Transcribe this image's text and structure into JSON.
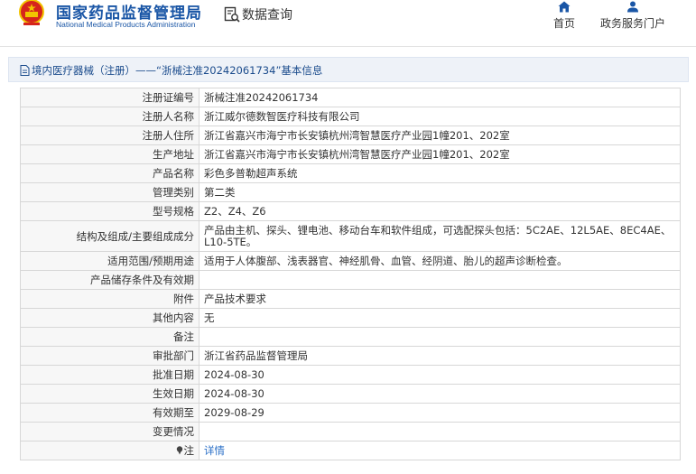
{
  "header": {
    "brand_cn": "国家药品监督管理局",
    "brand_en": "National Medical Products Administration",
    "query_label": "数据查询",
    "nav": {
      "home": "首页",
      "portal": "政务服务门户"
    }
  },
  "breadcrumb": {
    "text": "境内医疗器械（注册）——“浙械注准20242061734”基本信息"
  },
  "rows": [
    {
      "label": "注册证编号",
      "value": "浙械注准20242061734"
    },
    {
      "label": "注册人名称",
      "value": "浙江威尔德数智医疗科技有限公司"
    },
    {
      "label": "注册人住所",
      "value": "浙江省嘉兴市海宁市长安镇杭州湾智慧医疗产业园1幢201、202室"
    },
    {
      "label": "生产地址",
      "value": "浙江省嘉兴市海宁市长安镇杭州湾智慧医疗产业园1幢201、202室"
    },
    {
      "label": "产品名称",
      "value": "彩色多普勒超声系统"
    },
    {
      "label": "管理类别",
      "value": "第二类"
    },
    {
      "label": "型号规格",
      "value": "Z2、Z4、Z6"
    },
    {
      "label": "结构及组成/主要组成成分",
      "value": "产品由主机、探头、锂电池、移动台车和软件组成，可选配探头包括：5C2AE、12L5AE、8EC4AE、L10-5TE。"
    },
    {
      "label": "适用范围/预期用途",
      "value": "适用于人体腹部、浅表器官、神经肌骨、血管、经阴道、胎儿的超声诊断检查。"
    },
    {
      "label": "产品储存条件及有效期",
      "value": ""
    },
    {
      "label": "附件",
      "value": "产品技术要求"
    },
    {
      "label": "其他内容",
      "value": "无"
    },
    {
      "label": "备注",
      "value": ""
    },
    {
      "label": "审批部门",
      "value": "浙江省药品监督管理局"
    },
    {
      "label": "批准日期",
      "value": "2024-08-30"
    },
    {
      "label": "生效日期",
      "value": "2024-08-30"
    },
    {
      "label": "有效期至",
      "value": "2029-08-29"
    },
    {
      "label": "变更情况",
      "value": ""
    },
    {
      "label": "注",
      "value": "详情"
    }
  ],
  "colors": {
    "brand_blue": "#1a56a6",
    "link_blue": "#2a6fc7",
    "emblem_red": "#d6241c",
    "emblem_gold": "#f2c400"
  }
}
